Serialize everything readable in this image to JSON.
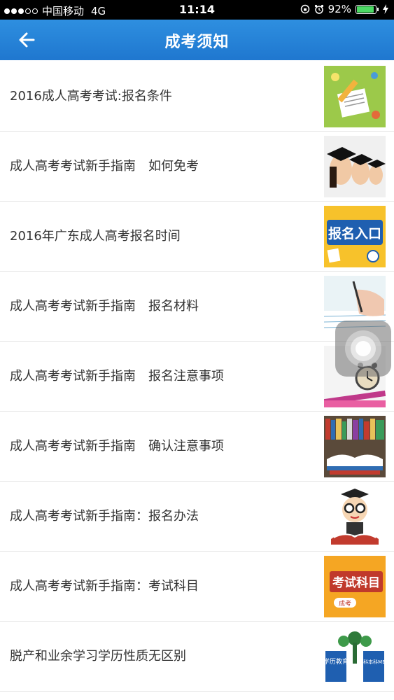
{
  "status_bar": {
    "carrier": "中国移动",
    "network": "4G",
    "time": "11:14",
    "battery_percent": "92%",
    "battery_level": 0.92
  },
  "header": {
    "title": "成考须知",
    "back_icon": "arrow-left-icon"
  },
  "articles": [
    {
      "title": "2016成人高考考试:报名条件",
      "thumb_icon": "exam-paper-pencil-icon"
    },
    {
      "title": "成人高考考试新手指南　如何免考",
      "thumb_icon": "graduates-caps-icon"
    },
    {
      "title": "2016年广东成人高考报名时间",
      "thumb_icon": "registration-entrance-icon",
      "thumb_text": "报名入口"
    },
    {
      "title": "成人高考考试新手指南　报名材料",
      "thumb_icon": "hand-writing-icon"
    },
    {
      "title": "成人高考考试新手指南　报名注意事项",
      "thumb_icon": "alarm-clock-books-icon"
    },
    {
      "title": "成人高考考试新手指南　确认注意事项",
      "thumb_icon": "bookshelf-icon"
    },
    {
      "title": "成人高考考试新手指南：报名办法",
      "thumb_icon": "scholar-cartoon-icon"
    },
    {
      "title": "成人高考考试新手指南：考试科目",
      "thumb_icon": "exam-subjects-icon",
      "thumb_text": "考试科目",
      "thumb_subtext": "成考"
    },
    {
      "title": "脱产和业余学习学历性质无区别",
      "thumb_icon": "education-tree-icon",
      "thumb_text_left": "学历教育",
      "thumb_text_right": "专科本科MBA"
    }
  ],
  "colors": {
    "header_blue": "#1f7fd6",
    "text": "#333333",
    "divider": "#e6e6e6"
  }
}
